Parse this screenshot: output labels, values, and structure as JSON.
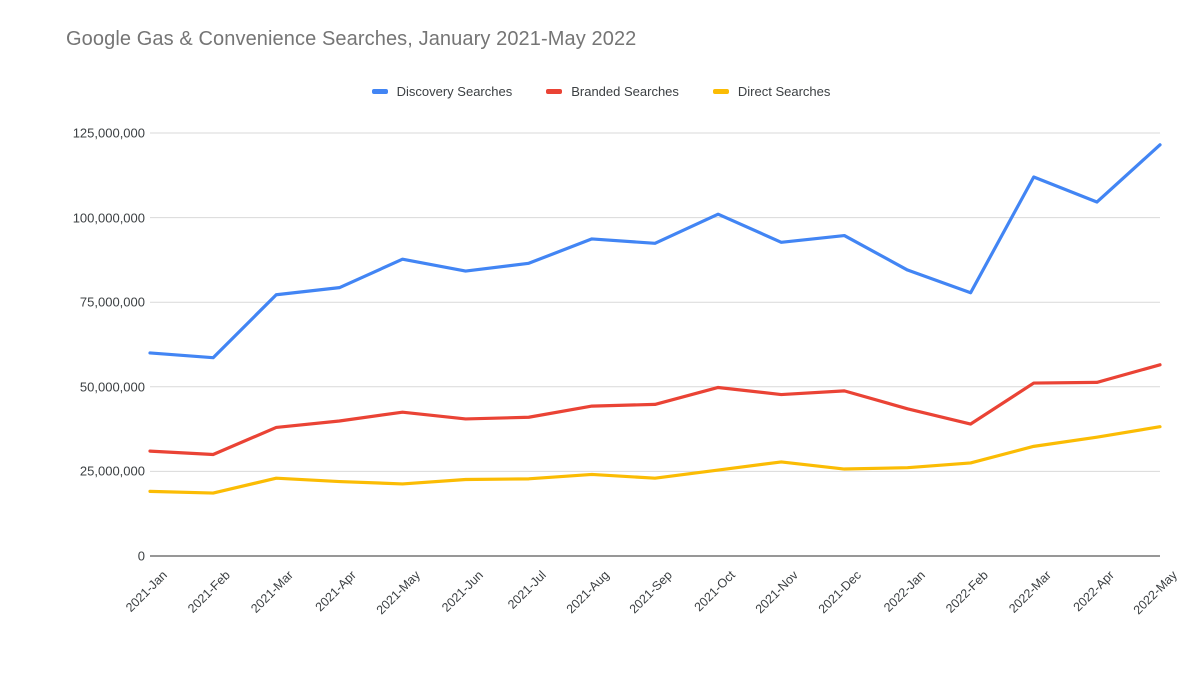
{
  "chart_data": {
    "type": "line",
    "title": "Google Gas & Convenience Searches, January 2021-May 2022",
    "xlabel": "",
    "ylabel": "",
    "grid": true,
    "legend_position": "top-center",
    "ylim": [
      0,
      125000000
    ],
    "y_ticks": [
      0,
      25000000,
      50000000,
      75000000,
      100000000,
      125000000
    ],
    "y_tick_labels": [
      "0",
      "25,000,000",
      "50,000,000",
      "75,000,000",
      "100,000,000",
      "125,000,000"
    ],
    "categories": [
      "2021-Jan",
      "2021-Feb",
      "2021-Mar",
      "2021-Apr",
      "2021-May",
      "2021-Jun",
      "2021-Jul",
      "2021-Aug",
      "2021-Sep",
      "2021-Oct",
      "2021-Nov",
      "2021-Dec",
      "2022-Jan",
      "2022-Feb",
      "2022-Mar",
      "2022-Apr",
      "2022-May"
    ],
    "series": [
      {
        "name": "Discovery Searches",
        "color": "#4285f4",
        "values": [
          60000000,
          58600000,
          77200000,
          79300000,
          87700000,
          84200000,
          86500000,
          93700000,
          92400000,
          101000000,
          92700000,
          94700000,
          84500000,
          77800000,
          112000000,
          104600000,
          121500000
        ]
      },
      {
        "name": "Branded Searches",
        "color": "#ea4335",
        "values": [
          31000000,
          30000000,
          38000000,
          39900000,
          42500000,
          40500000,
          41000000,
          44300000,
          44800000,
          49800000,
          47700000,
          48800000,
          43500000,
          39000000,
          51100000,
          51300000,
          56500000
        ]
      },
      {
        "name": "Direct Searches",
        "color": "#fbbc04",
        "values": [
          19100000,
          18600000,
          23000000,
          22000000,
          21300000,
          22600000,
          22800000,
          24100000,
          23000000,
          25400000,
          27800000,
          25700000,
          26100000,
          27500000,
          32400000,
          35100000,
          38200000
        ]
      }
    ]
  }
}
